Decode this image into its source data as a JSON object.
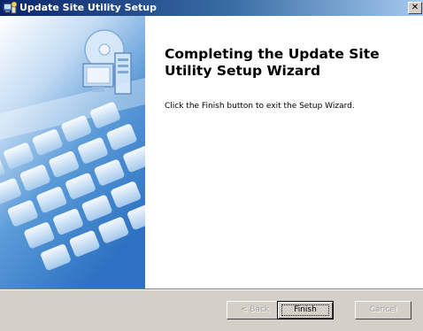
{
  "window": {
    "title": "Update Site Utility Setup",
    "close_glyph": "✕"
  },
  "content": {
    "heading": "Completing the Update Site Utility Setup Wizard",
    "message": "Click the Finish button to exit the Setup Wizard."
  },
  "buttons": {
    "back": "< Back",
    "finish": "Finish",
    "cancel": "Cancel"
  },
  "icons": {
    "title_icon": "setup-installer-icon",
    "art_icon": "computer-cd-icon"
  },
  "colors": {
    "titlebar_start": "#0a246a",
    "titlebar_end": "#a6caf0",
    "dialog_face": "#d4d0c8",
    "art_blue": "#3a7fc8"
  }
}
